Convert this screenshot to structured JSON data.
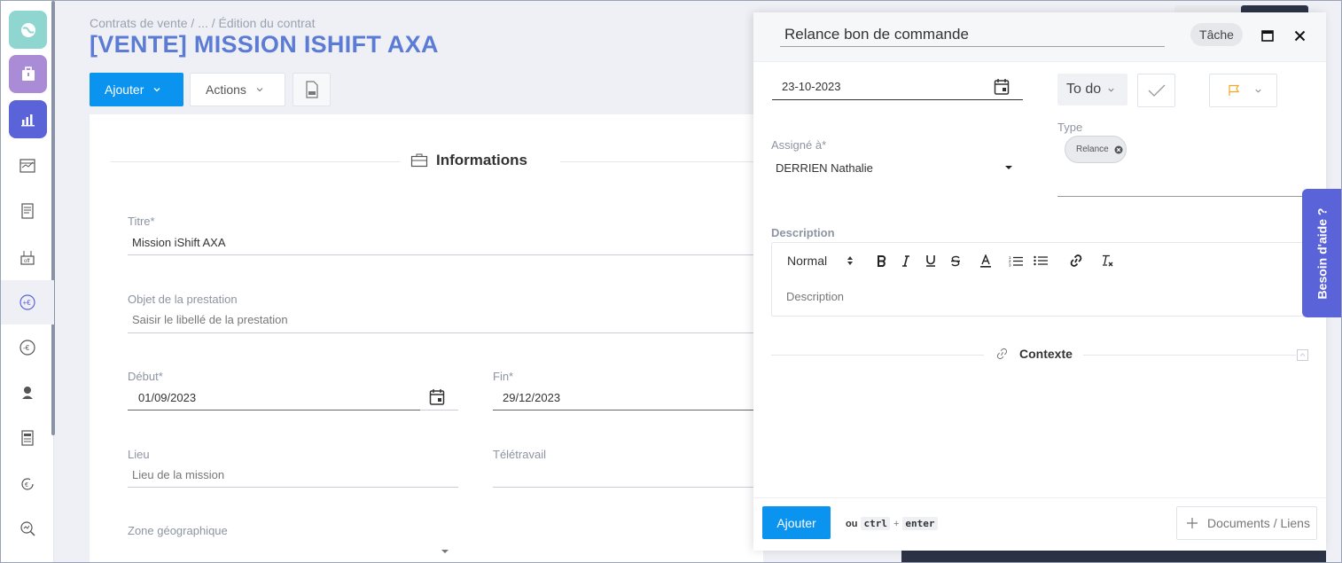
{
  "breadcrumb": "Contrats de vente  /  ...  /  Édition du contrat",
  "page_title": "[VENTE] MISSION ISHIFT AXA",
  "toolbar": {
    "add_label": "Ajouter",
    "actions_label": "Actions",
    "doc_icon": "doc-file-icon"
  },
  "sidebar": {
    "items": [
      {
        "icon": "globe-icon",
        "color": "#7fd1cc"
      },
      {
        "icon": "briefcase-icon",
        "color": "#a98bd6"
      },
      {
        "icon": "bar-chart-icon",
        "color": "#5b63d8"
      },
      {
        "icon": "calendar-chart-icon"
      },
      {
        "icon": "receipt-icon"
      },
      {
        "icon": "building-icon"
      },
      {
        "icon": "euro-plus-icon"
      },
      {
        "icon": "euro-minus-icon"
      },
      {
        "icon": "user-pin-icon"
      },
      {
        "icon": "document-list-icon"
      },
      {
        "icon": "euro-cycle-icon"
      },
      {
        "icon": "search-chart-icon"
      }
    ]
  },
  "form": {
    "section_title": "Informations",
    "titre": {
      "label": "Titre*",
      "value": "Mission iShift AXA"
    },
    "objet": {
      "label": "Objet de la prestation",
      "placeholder": "Saisir le libellé de la prestation"
    },
    "debut": {
      "label": "Début*",
      "value": "01/09/2023"
    },
    "fin": {
      "label": "Fin*",
      "value": "29/12/2023"
    },
    "lieu": {
      "label": "Lieu",
      "placeholder": "Lieu de la mission"
    },
    "teletravail": {
      "label": "Télétravail"
    },
    "zone": {
      "label": "Zone géographique"
    }
  },
  "task_panel": {
    "title_value": "Relance bon de commande",
    "type_pill": "Tâche",
    "date": "23-10-2023",
    "status": "To do",
    "assignee_label": "Assigné à*",
    "assignee_value": "DERRIEN Nathalie",
    "type_label": "Type",
    "type_chip": "Relance",
    "description_label": "Description",
    "editor": {
      "format": "Normal",
      "placeholder": "Description"
    },
    "contexte_label": "Contexte",
    "footer": {
      "add_label": "Ajouter",
      "shortcut_or": "ou",
      "shortcut_ctrl": "ctrl",
      "shortcut_plus": "+",
      "shortcut_enter": "enter",
      "docs_label": "Documents / Liens"
    },
    "accent_color": "#0b93f0"
  },
  "help_tab": "Besoin d'aide ?"
}
